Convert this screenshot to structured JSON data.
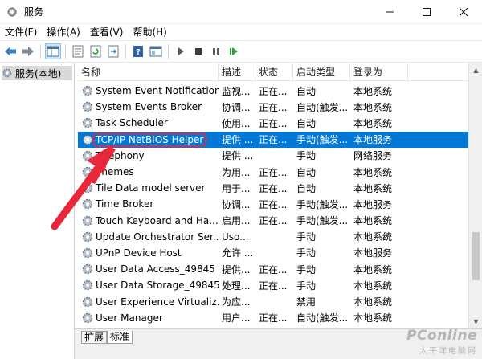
{
  "window": {
    "title": "服务"
  },
  "menu": [
    {
      "label": "文件(F)"
    },
    {
      "label": "操作(A)"
    },
    {
      "label": "查看(V)"
    },
    {
      "label": "帮助(H)"
    }
  ],
  "toolbar": {
    "buttons": [
      "back-icon",
      "forward-icon",
      "console-tree-icon",
      "properties-icon",
      "refresh-icon",
      "export-list-icon",
      "help-icon",
      "console-icon",
      "start-icon",
      "stop-icon",
      "pause-icon",
      "restart-icon"
    ]
  },
  "tree": {
    "selected_label": "服务(本地)"
  },
  "columns": {
    "name": "名称",
    "desc": "描述",
    "status": "状态",
    "startup": "启动类型",
    "logon": "登录为"
  },
  "services": [
    {
      "name": "System Event Notification...",
      "desc": "监视...",
      "status": "正在...",
      "startup": "自动",
      "logon": "本地系统"
    },
    {
      "name": "System Events Broker",
      "desc": "协调...",
      "status": "正在...",
      "startup": "自动(触发...",
      "logon": "本地系统"
    },
    {
      "name": "Task Scheduler",
      "desc": "使用...",
      "status": "正在...",
      "startup": "自动",
      "logon": "本地系统"
    },
    {
      "name": "TCP/IP NetBIOS Helper",
      "desc": "提供 ...",
      "status": "正在...",
      "startup": "手动(触发...",
      "logon": "本地服务",
      "selected": true
    },
    {
      "name": "Telephony",
      "desc": "提供 ...",
      "status": "",
      "startup": "手动",
      "logon": "网络服务"
    },
    {
      "name": "Themes",
      "desc": "为用...",
      "status": "正在...",
      "startup": "自动",
      "logon": "本地系统"
    },
    {
      "name": "Tile Data model server",
      "desc": "用于...",
      "status": "正在...",
      "startup": "自动",
      "logon": "本地系统"
    },
    {
      "name": "Time Broker",
      "desc": "协调...",
      "status": "正在...",
      "startup": "手动(触发...",
      "logon": "本地服务"
    },
    {
      "name": "Touch Keyboard and Ha...",
      "desc": "启用...",
      "status": "正在...",
      "startup": "手动(触发...",
      "logon": "本地系统"
    },
    {
      "name": "Update Orchestrator Ser...",
      "desc": "Uso...",
      "status": "",
      "startup": "手动",
      "logon": "本地系统"
    },
    {
      "name": "UPnP Device Host",
      "desc": "允许 ...",
      "status": "",
      "startup": "手动",
      "logon": "本地服务"
    },
    {
      "name": "User Data Access_49845",
      "desc": "提供...",
      "status": "正在...",
      "startup": "手动",
      "logon": "本地系统"
    },
    {
      "name": "User Data Storage_49845",
      "desc": "处理...",
      "status": "正在...",
      "startup": "手动",
      "logon": "本地系统"
    },
    {
      "name": "User Experience Virtualiz...",
      "desc": "为应...",
      "status": "",
      "startup": "禁用",
      "logon": "本地系统"
    },
    {
      "name": "User Manager",
      "desc": "用户...",
      "status": "正在...",
      "startup": "自动(触发...",
      "logon": "本地系统"
    }
  ],
  "tabs": [
    {
      "label": "扩展"
    },
    {
      "label": "标准"
    }
  ],
  "watermark": {
    "brand": "PConline",
    "sub": "太平洋电脑网"
  },
  "colors": {
    "selection": "#0078d7",
    "highlight": "#e8283a",
    "arrow": "#e8283a"
  }
}
